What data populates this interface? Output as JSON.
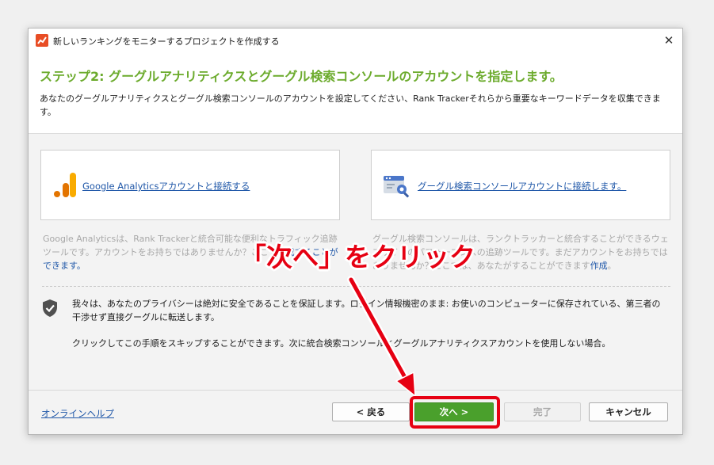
{
  "window": {
    "title": "新しいランキングをモニターするプロジェクトを作成する",
    "close_glyph": "✕"
  },
  "header": {
    "step_title": "ステップ2: グーグルアナリティクスとグーグル検索コンソールのアカウントを指定します。",
    "description": "あなたのグーグルアナリティクスとグーグル検索コンソールのアカウントを設定してください、Rank Trackerそれらから重要なキーワードデータを収集できます。"
  },
  "cards": {
    "ga": {
      "icon": "google-analytics-icon",
      "link": "Google Analyticsアカウントと接続する",
      "note_text": "Google Analyticsは、Rank Trackerと統合可能な便利なトラフィック追跡ツールです。アカウントをお持ちではありませんか？ここで",
      "note_link_1": "作成",
      "note_link_2": "することができます。"
    },
    "gsc": {
      "icon": "search-console-icon",
      "link": "グーグル検索コンソールアカウントに接続します。",
      "note_text": "グーグル検索コンソールは、ランクトラッカーと統合することができるウェブサイトのパフォーマンスの追跡ツールです。まだアカウントをお持ちではありませんか？ここでは、あなたがすることができます",
      "note_link": "作成",
      "note_end": "。"
    }
  },
  "privacy": {
    "icon": "shield-check-icon",
    "text": "我々は、あなたのプライバシーは絶対に安全であることを保証します。ログイン情報機密のまま: お使いのコンピューターに保存されている、第三者の干渉せず直接グーグルに転送します。",
    "skip_text": "クリックしてこの手順をスキップすることができます。次に統合検索コンソールとグーグルアナリティクスアカウントを使用しない場合。"
  },
  "footer": {
    "help_link": "オンラインヘルプ",
    "back_label": "< 戻る",
    "next_label": "次へ >",
    "finish_label": "完了",
    "cancel_label": "キャンセル"
  },
  "annotation": {
    "text": "「次へ」をクリック",
    "color": "#e60012"
  },
  "colors": {
    "accent_green": "#6cab2d",
    "link_blue": "#1f57a8",
    "next_button": "#4aa02c"
  }
}
